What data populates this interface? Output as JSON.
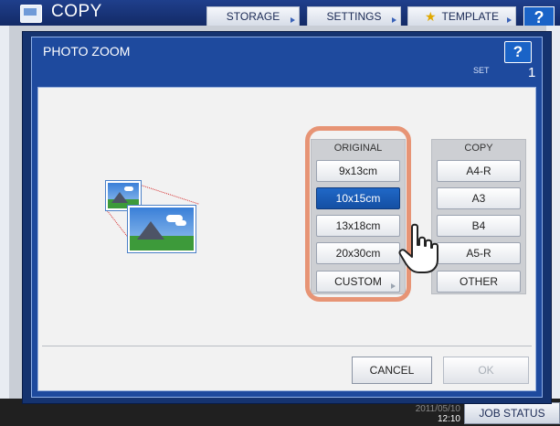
{
  "app": {
    "title": "COPY",
    "icon": "copier-icon"
  },
  "top_tabs": [
    {
      "label": "STORAGE"
    },
    {
      "label": "SETTINGS"
    },
    {
      "label": "TEMPLATE",
      "icon": "star-icon"
    }
  ],
  "help_label": "?",
  "dialog": {
    "title": "PHOTO ZOOM",
    "help_label": "?",
    "set_label": "SET",
    "set_count": "1"
  },
  "original": {
    "label": "ORIGINAL",
    "options": [
      "9x13cm",
      "10x15cm",
      "13x18cm",
      "20x30cm",
      "CUSTOM"
    ],
    "selected": "10x15cm"
  },
  "copy": {
    "label": "COPY",
    "options": [
      "A4-R",
      "A3",
      "B4",
      "A5-R",
      "OTHER"
    ]
  },
  "actions": {
    "cancel": "CANCEL",
    "ok": "OK"
  },
  "status_bar": {
    "date": "2011/05/10",
    "time": "12:10",
    "job_status": "JOB STATUS"
  },
  "colors": {
    "accent": "#1e4a9e",
    "selected": "#1a5bb5",
    "highlight": "#e79475"
  }
}
